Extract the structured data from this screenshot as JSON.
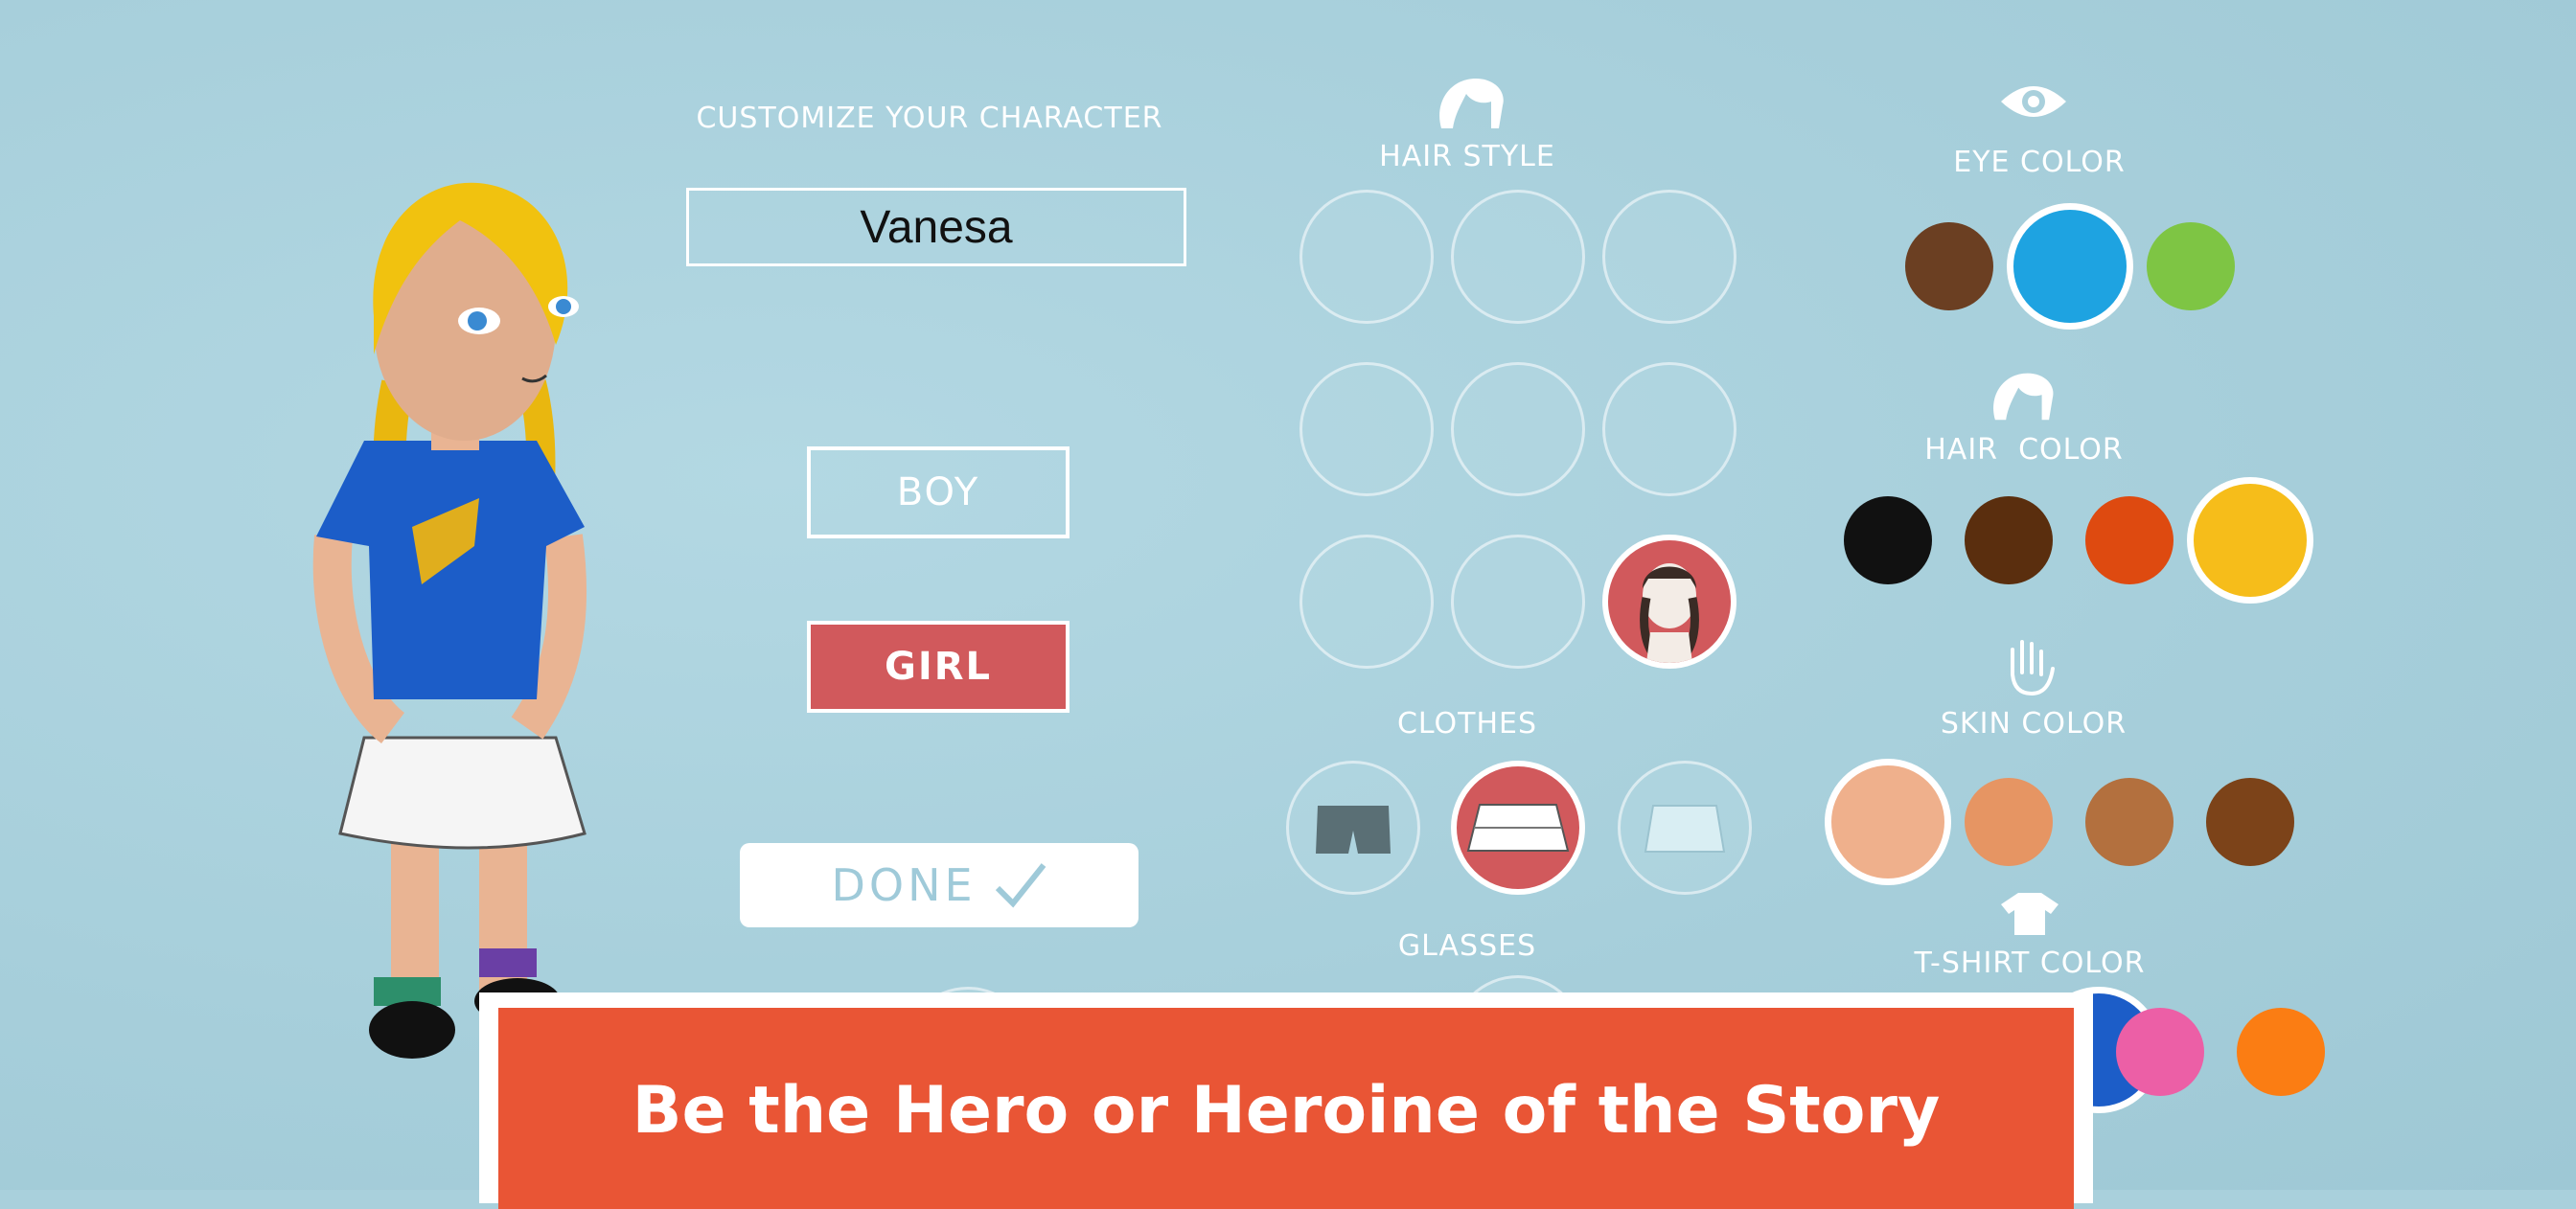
{
  "header": {
    "title": "CUSTOMIZE YOUR CHARACTER"
  },
  "name_field": {
    "value": "Vanesa"
  },
  "gender": {
    "boy_label": "BOY",
    "girl_label": "GIRL",
    "selected": "GIRL"
  },
  "done": {
    "label": "DONE",
    "icon": "checkmark-icon"
  },
  "sections": {
    "hair_style": "HAIR STYLE",
    "clothes": "CLOTHES",
    "glasses": "GLASSES",
    "eye_color": "EYE COLOR",
    "hair_color": "HAIR  COLOR",
    "skin_color": "SKIN COLOR",
    "tshirt_color": "T-SHIRT COLOR"
  },
  "colors": {
    "eye": [
      "#6b3f22",
      "#1ea3e1",
      "#7ec544"
    ],
    "eye_selected": 1,
    "hair": [
      "#111111",
      "#5a2e0e",
      "#de4a10",
      "#f6bd1a"
    ],
    "hair_selected": 3,
    "skin": [
      "#efb08c",
      "#e69563",
      "#b3703e",
      "#7c4319"
    ],
    "skin_selected": 0,
    "tshirt": [
      "#ec5fa6",
      "#fb7d13"
    ],
    "accent": "#d1595c"
  },
  "banner": {
    "text": "Be the Hero or Heroine of the Story"
  }
}
